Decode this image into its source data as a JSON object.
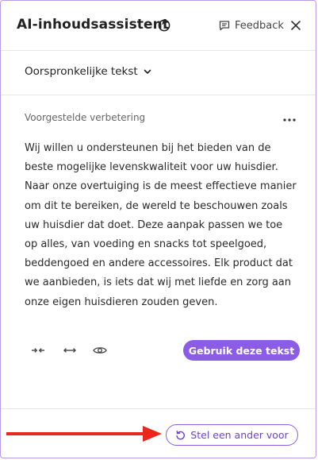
{
  "header": {
    "title": "AI-inhoudsassistent",
    "feedback_label": "Feedback"
  },
  "original": {
    "dropdown_label": "Oorspronkelijke tekst"
  },
  "suggestion": {
    "label": "Voorgestelde verbetering",
    "text": "Wij willen u ondersteunen bij het bieden van de beste mogelijke levenskwaliteit voor uw huisdier. Naar onze overtuiging is de meest effectieve manier om dit te bereiken, de wereld te beschouwen zoals uw huisdier dat doet. Deze aanpak passen we toe op alles, van voeding en snacks tot speelgoed, beddengoed en andere accessoires. Elk product dat we aanbieden, is iets dat wij met liefde en zorg aan onze eigen huisdieren zouden geven.",
    "use_button_label": "Gebruik deze tekst"
  },
  "footer": {
    "other_button_label": "Stel een ander voor"
  },
  "icons": {
    "help": "help-circle-icon",
    "feedback": "chat-bubble-icon",
    "close": "close-icon",
    "more": "more-horizontal-icon",
    "shorten": "shorten-icon",
    "expand": "expand-icon",
    "preview": "eye-icon",
    "regenerate": "refresh-icon"
  },
  "colors": {
    "accent": "#8b5ce6",
    "panel_border": "#b79ae6",
    "annotation_arrow": "#e8281c"
  }
}
